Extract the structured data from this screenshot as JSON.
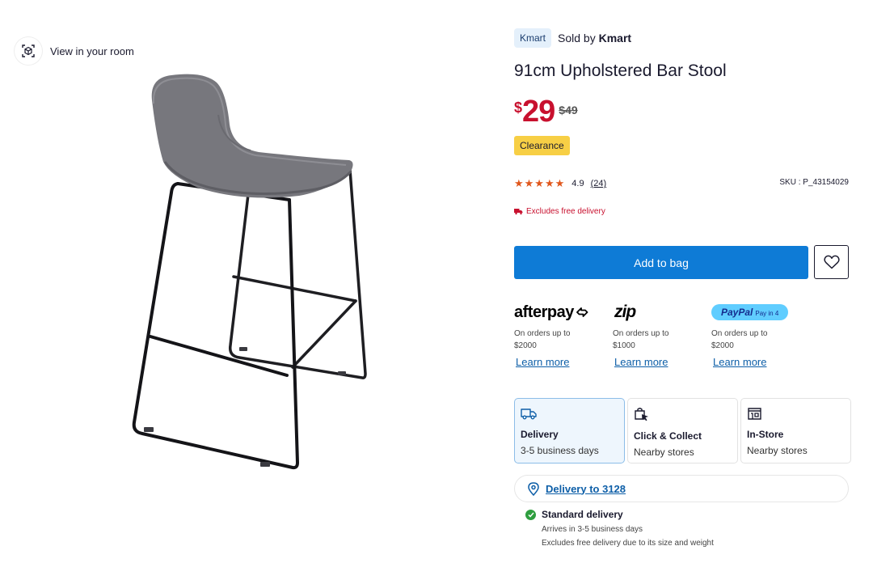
{
  "gallery": {
    "view_in_room_label": "View in your room"
  },
  "product": {
    "brand_badge": "Kmart",
    "sold_by_prefix": "Sold by",
    "sold_by_name": "Kmart",
    "title": "91cm Upholstered Bar Stool",
    "currency_symbol": "$",
    "price": "29",
    "was_price": "$49",
    "badge": "Clearance",
    "rating": "4.9",
    "review_count": "(24)",
    "sku": "SKU : P_43154029",
    "delivery_note": "Excludes free delivery",
    "add_to_bag_label": "Add to bag"
  },
  "payments": [
    {
      "name": "afterpay",
      "logo_text": "afterpay",
      "desc": "On orders up to $2000",
      "learn_more": "Learn more"
    },
    {
      "name": "zip",
      "logo_text": "zip",
      "desc": "On orders up to $1000",
      "learn_more": "Learn more"
    },
    {
      "name": "paypal",
      "logo_text": "PayPal",
      "logo_sub": "Pay in 4",
      "desc": "On orders up to $2000",
      "learn_more": "Learn more"
    }
  ],
  "fulfilment": [
    {
      "title": "Delivery",
      "sub": "3-5 business days",
      "icon": "truck-icon",
      "selected": true
    },
    {
      "title": "Click & Collect",
      "sub": "Nearby stores",
      "icon": "bag-cursor-icon",
      "selected": false
    },
    {
      "title": "In-Store",
      "sub": "Nearby stores",
      "icon": "store-icon",
      "selected": false
    }
  ],
  "location": {
    "label": "Delivery to 3128",
    "icon": "location-pin-icon"
  },
  "standard_delivery": {
    "title": "Standard delivery",
    "line1": "Arrives in 3-5 business days",
    "line2": "Excludes free delivery due to its size and weight"
  },
  "colors": {
    "price_red": "#c8102e",
    "primary_blue": "#0e7bd6",
    "star_orange": "#e0571c",
    "clearance_yellow": "#f7cf45"
  }
}
